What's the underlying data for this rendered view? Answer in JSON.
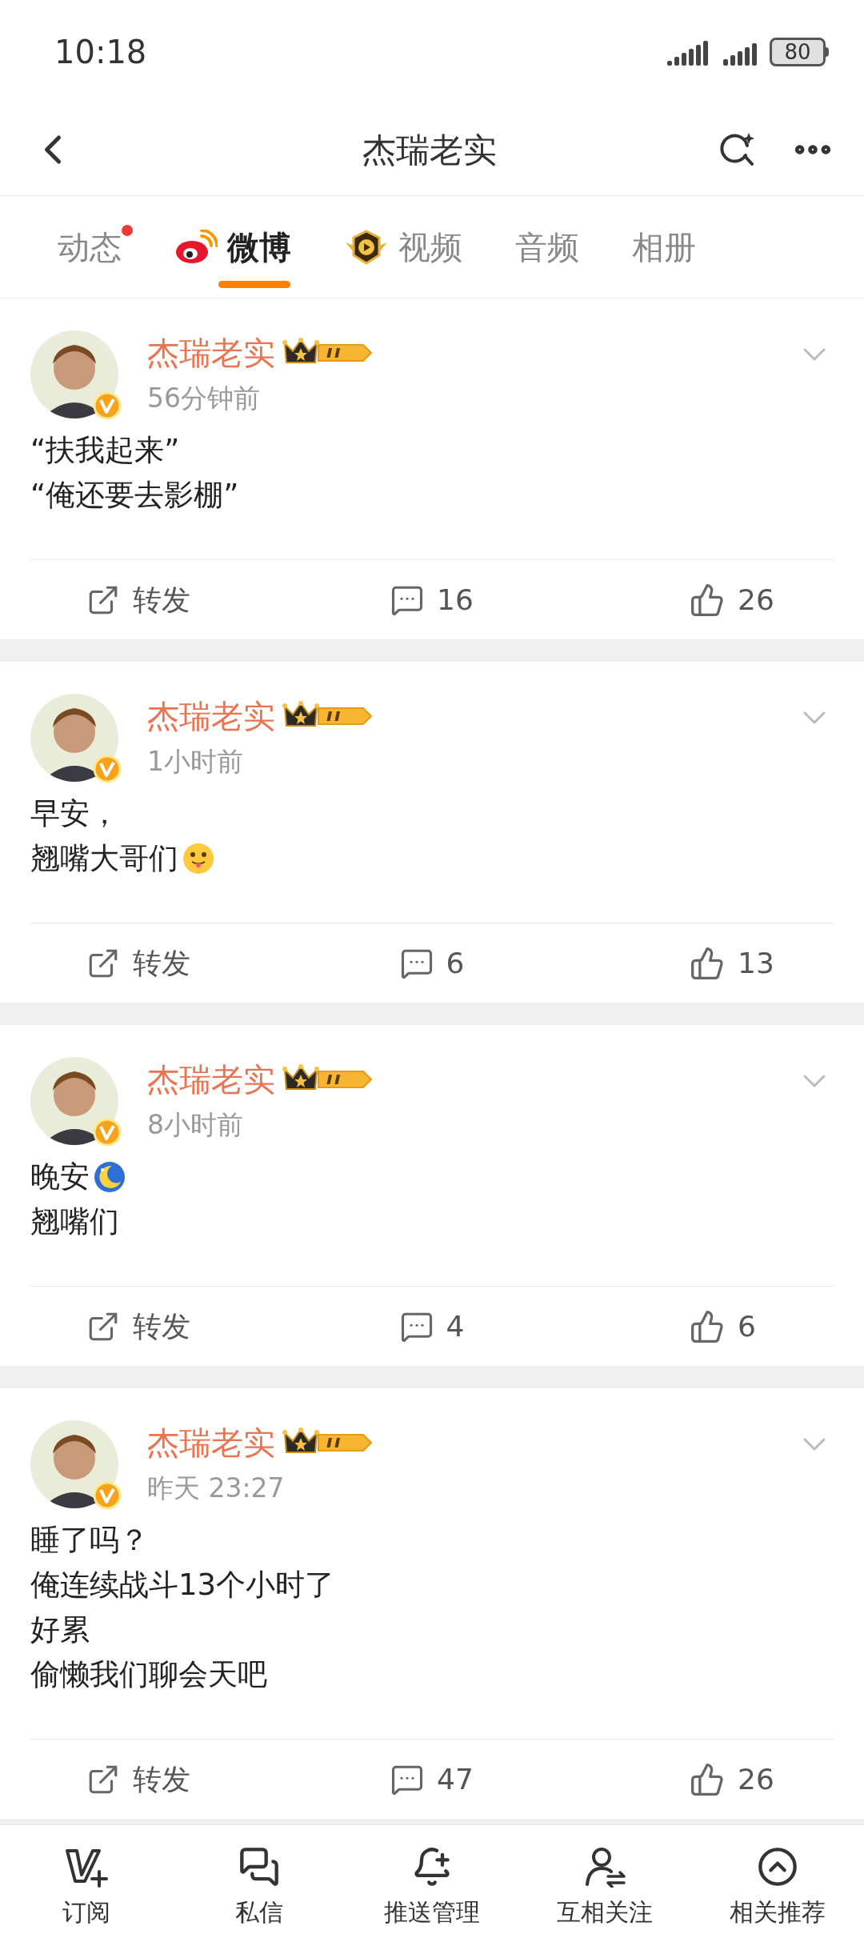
{
  "status_bar": {
    "time": "10:18",
    "battery": "80"
  },
  "header": {
    "title": "杰瑞老实"
  },
  "tabs": [
    {
      "label": "动态",
      "selected": false,
      "badge": true
    },
    {
      "label": "微博",
      "selected": true,
      "badge": false
    },
    {
      "label": "视频",
      "selected": false,
      "badge": false
    },
    {
      "label": "音频",
      "selected": false,
      "badge": false
    },
    {
      "label": "相册",
      "selected": false,
      "badge": false
    }
  ],
  "posts": [
    {
      "author": "杰瑞老实",
      "time": "56分钟前",
      "lines": [
        {
          "text": "“扶我起来”",
          "kind": "plain"
        },
        {
          "text": "“俺还要去影棚”",
          "kind": "plain"
        }
      ],
      "repost": "转发",
      "comments": "16",
      "likes": "26"
    },
    {
      "author": "杰瑞老实",
      "time": "1小时前",
      "lines": [
        {
          "text": "早安，",
          "kind": "plain"
        },
        {
          "text": "翘嘴大哥们",
          "kind": "tongue"
        }
      ],
      "repost": "转发",
      "comments": "6",
      "likes": "13"
    },
    {
      "author": "杰瑞老实",
      "time": "8小时前",
      "lines": [
        {
          "text": "晚安",
          "kind": "moon"
        },
        {
          "text": "翘嘴们",
          "kind": "plain"
        }
      ],
      "repost": "转发",
      "comments": "4",
      "likes": "6"
    },
    {
      "author": "杰瑞老实",
      "time": "昨天 23:27",
      "lines": [
        {
          "text": "睡了吗？",
          "kind": "plain"
        },
        {
          "text": "俺连续战斗13个小时了",
          "kind": "plain"
        },
        {
          "text": "好累",
          "kind": "plain"
        },
        {
          "text": "偷懒我们聊会天吧",
          "kind": "plain"
        }
      ],
      "repost": "转发",
      "comments": "47",
      "likes": "26"
    }
  ],
  "bottom_nav": [
    {
      "label": "订阅"
    },
    {
      "label": "私信"
    },
    {
      "label": "推送管理"
    },
    {
      "label": "互相关注"
    },
    {
      "label": "相关推荐"
    }
  ]
}
